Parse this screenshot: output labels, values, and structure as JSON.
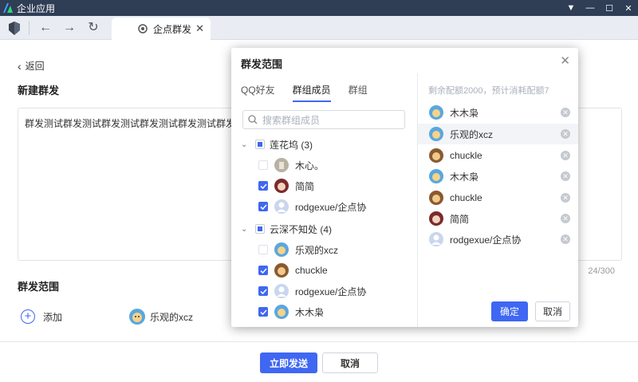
{
  "window": {
    "title": "企业应用",
    "controls": [
      "chevron-down-icon",
      "minimize-icon",
      "maximize-icon",
      "close-icon"
    ]
  },
  "tab": {
    "label": "企点群发"
  },
  "page": {
    "back_label": "返回",
    "new_title": "新建群发",
    "message": "群发测试群发测试群发测试群发测试群发测试群发测试",
    "char_count": "24/300",
    "scope_title": "群发范围",
    "add_label": "添加",
    "chosen": "乐观的xcz",
    "send_label": "立即发送",
    "cancel_label": "取消"
  },
  "dialog": {
    "title": "群发范围",
    "tabs": [
      "QQ好友",
      "群组成员",
      "群组"
    ],
    "active_tab": 1,
    "search_placeholder": "搜索群组成员",
    "groups": [
      {
        "name": "莲花坞 (3)",
        "state": "partial",
        "members": [
          {
            "name": "木心。",
            "checked": false,
            "avatar": "photo"
          },
          {
            "name": "简简",
            "checked": true,
            "avatar": "anime"
          },
          {
            "name": "rodgexue/企点协",
            "checked": true,
            "avatar": "default"
          }
        ]
      },
      {
        "name": "云深不知处 (4)",
        "state": "partial",
        "members": [
          {
            "name": "乐观的xcz",
            "checked": false,
            "avatar": "cartoon"
          },
          {
            "name": "chuckle",
            "checked": true,
            "avatar": "monkey"
          },
          {
            "name": "rodgexue/企点协",
            "checked": true,
            "avatar": "default"
          },
          {
            "name": "木木枭",
            "checked": true,
            "avatar": "cartoon"
          }
        ]
      }
    ],
    "hint": "剩余配额2000，预计消耗配额7",
    "selected": [
      {
        "name": "木木枭",
        "avatar": "cartoon"
      },
      {
        "name": "乐观的xcz",
        "avatar": "cartoon"
      },
      {
        "name": "chuckle",
        "avatar": "monkey"
      },
      {
        "name": "木木枭",
        "avatar": "cartoon"
      },
      {
        "name": "chuckle",
        "avatar": "monkey"
      },
      {
        "name": "简简",
        "avatar": "anime"
      },
      {
        "name": "rodgexue/企点协",
        "avatar": "default"
      }
    ],
    "highlighted_index": 1,
    "confirm_label": "确定",
    "cancel_label": "取消"
  },
  "colors": {
    "accent": "#3f67f2",
    "titlebar": "#2f3d55",
    "toolbar": "#e9edf3"
  }
}
